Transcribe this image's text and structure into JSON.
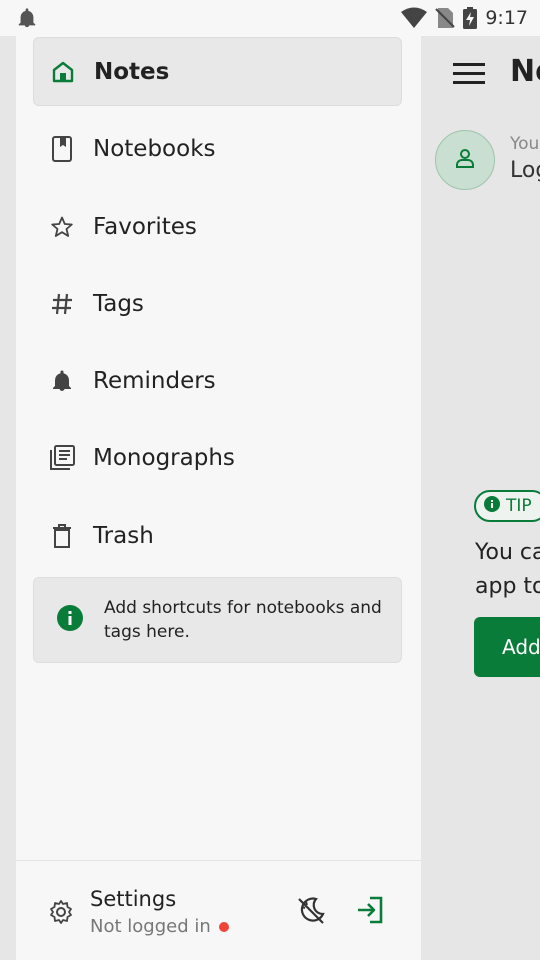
{
  "status_bar": {
    "time": "9:17"
  },
  "main": {
    "title": "No",
    "account_line1": "You",
    "account_line2": "Log",
    "tip_badge": "TIP",
    "tip_text_line1": "You ca",
    "tip_text_line2": "app to",
    "tip_button": "Add"
  },
  "drawer": {
    "nav_items": [
      {
        "label": "Notes",
        "icon": "home-icon",
        "active": true
      },
      {
        "label": "Notebooks",
        "icon": "notebook-icon"
      },
      {
        "label": "Favorites",
        "icon": "star-icon"
      },
      {
        "label": "Tags",
        "icon": "hashtag-icon"
      },
      {
        "label": "Reminders",
        "icon": "bell-icon"
      },
      {
        "label": "Monographs",
        "icon": "monograph-icon"
      },
      {
        "label": "Trash",
        "icon": "trash-icon"
      }
    ],
    "shortcut_hint": "Add shortcuts for notebooks and tags here.",
    "footer": {
      "settings_label": "Settings",
      "login_status": "Not logged in"
    }
  },
  "colors": {
    "accent": "#0a7c3a",
    "drawer_bg": "#f7f7f7",
    "active_bg": "#e8e8e8",
    "status_dot": "#f04438"
  }
}
